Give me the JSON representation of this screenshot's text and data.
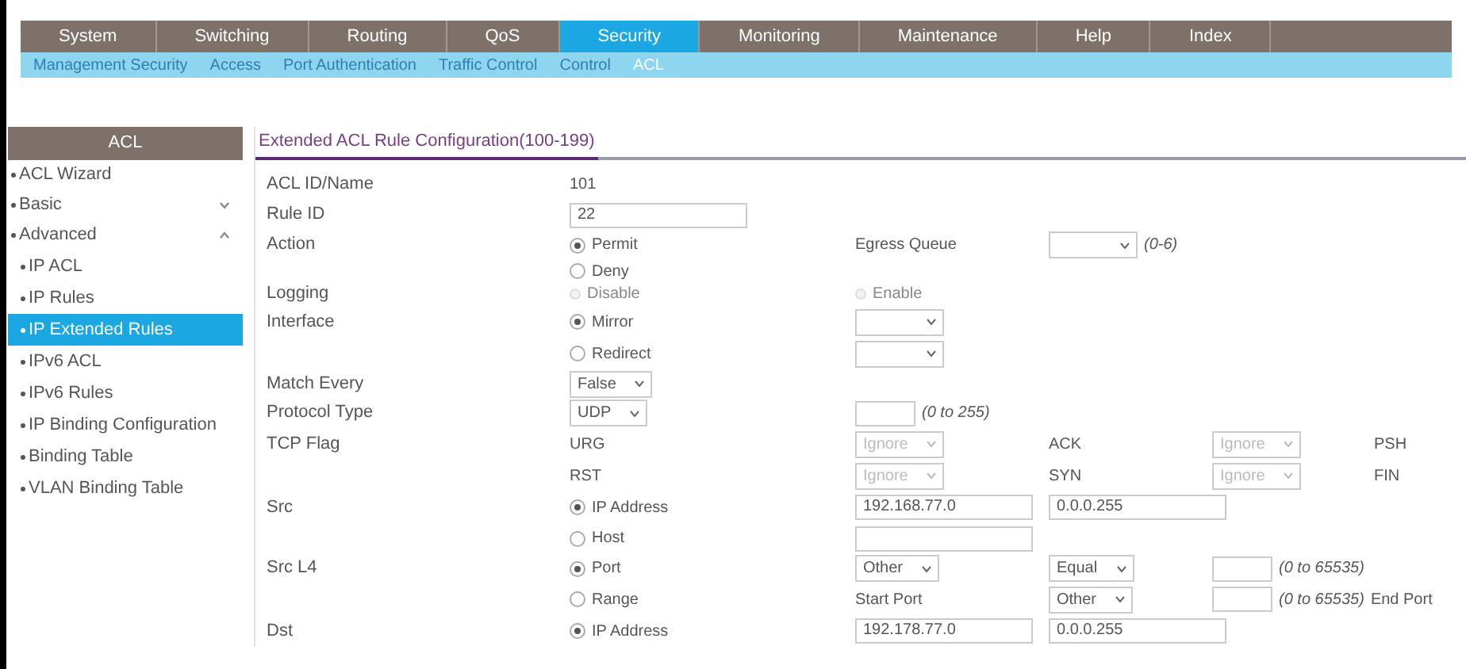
{
  "top_nav": [
    {
      "label": "System",
      "selected": false
    },
    {
      "label": "Switching",
      "selected": false
    },
    {
      "label": "Routing",
      "selected": false
    },
    {
      "label": "QoS",
      "selected": false
    },
    {
      "label": "Security",
      "selected": true
    },
    {
      "label": "Monitoring",
      "selected": false
    },
    {
      "label": "Maintenance",
      "selected": false
    },
    {
      "label": "Help",
      "selected": false
    },
    {
      "label": "Index",
      "selected": false
    }
  ],
  "sub_nav": [
    {
      "label": "Management Security",
      "selected": false
    },
    {
      "label": "Access",
      "selected": false
    },
    {
      "label": "Port Authentication",
      "selected": false
    },
    {
      "label": "Traffic Control",
      "selected": false
    },
    {
      "label": "Control",
      "selected": false
    },
    {
      "label": "ACL",
      "selected": true
    }
  ],
  "sidebar": {
    "title": "ACL",
    "items": [
      {
        "label": "ACL Wizard",
        "selected": false
      },
      {
        "label": "Basic",
        "selected": false,
        "expanded": false
      },
      {
        "label": "Advanced",
        "selected": false,
        "expanded": true,
        "children": [
          {
            "label": "IP ACL",
            "selected": false
          },
          {
            "label": "IP Rules",
            "selected": false
          },
          {
            "label": "IP Extended Rules",
            "selected": true
          },
          {
            "label": "IPv6 ACL",
            "selected": false
          },
          {
            "label": "IPv6 Rules",
            "selected": false
          },
          {
            "label": "IP Binding Configuration",
            "selected": false
          },
          {
            "label": "Binding Table",
            "selected": false
          },
          {
            "label": "VLAN Binding Table",
            "selected": false
          }
        ]
      }
    ]
  },
  "section_title": "Extended ACL Rule Configuration(100-199)",
  "form_rows": [
    {
      "label": "ACL ID/Name",
      "cells": [
        {
          "kind": "text",
          "text": "101"
        }
      ]
    },
    {
      "label": "Rule ID",
      "cells": [
        {
          "kind": "input",
          "value": "22"
        }
      ]
    },
    {
      "label": "Action",
      "cells": [
        {
          "kind": "radio",
          "text": "Permit",
          "selected": true,
          "disabled": false
        },
        {
          "kind": "text",
          "text": "Egress Queue"
        },
        {
          "kind": "select",
          "disabled": false
        },
        {
          "kind": "hint",
          "text": "(0-6)"
        }
      ]
    },
    {
      "cells": [
        {
          "kind": "radio",
          "text": "Deny",
          "selected": false,
          "disabled": false
        }
      ]
    },
    {
      "label": "Logging",
      "cells": [
        {
          "kind": "radio",
          "text": "Disable",
          "selected": false,
          "disabled": true
        },
        {
          "kind": "radio",
          "text": "Enable",
          "selected": false,
          "disabled": true
        }
      ]
    },
    {
      "label": "Interface",
      "cells": [
        {
          "kind": "radio",
          "text": "Mirror",
          "selected": true,
          "disabled": false
        },
        {
          "kind": "select",
          "disabled": false
        }
      ]
    },
    {
      "cells": [
        {
          "kind": "radio",
          "text": "Redirect",
          "selected": false,
          "disabled": false
        },
        {
          "kind": "select",
          "disabled": false
        }
      ]
    },
    {
      "label": "Match Every",
      "cells": [
        {
          "kind": "select",
          "value": "False",
          "disabled": false
        }
      ]
    },
    {
      "label": "Protocol Type",
      "cells": [
        {
          "kind": "select",
          "value": "UDP",
          "disabled": false
        },
        {
          "kind": "input"
        },
        {
          "kind": "hint",
          "text": "(0 to 255)"
        }
      ]
    },
    {
      "label": "TCP Flag",
      "cells": [
        {
          "kind": "text",
          "text": "URG"
        },
        {
          "kind": "select",
          "value": "Ignore",
          "disabled": true
        },
        {
          "kind": "text",
          "text": "ACK"
        },
        {
          "kind": "select",
          "value": "Ignore",
          "disabled": true
        },
        {
          "kind": "text",
          "text": "PSH"
        }
      ]
    },
    {
      "cells": [
        {
          "kind": "text",
          "text": "RST"
        },
        {
          "kind": "select",
          "value": "Ignore",
          "disabled": true
        },
        {
          "kind": "text",
          "text": "SYN"
        },
        {
          "kind": "select",
          "value": "Ignore",
          "disabled": true
        },
        {
          "kind": "text",
          "text": "FIN"
        }
      ]
    },
    {
      "label": "Src",
      "cells": [
        {
          "kind": "radio",
          "text": "IP Address",
          "selected": true,
          "disabled": false
        },
        {
          "kind": "input",
          "value": "192.168.77.0"
        },
        {
          "kind": "input",
          "value": "0.0.0.255"
        }
      ]
    },
    {
      "cells": [
        {
          "kind": "radio",
          "text": "Host",
          "selected": false,
          "disabled": false
        },
        {
          "kind": "input"
        }
      ]
    },
    {
      "label": "Src L4",
      "cells": [
        {
          "kind": "radio",
          "text": "Port",
          "selected": true,
          "disabled": false
        },
        {
          "kind": "select",
          "value": "Other",
          "disabled": false
        },
        {
          "kind": "select",
          "value": "Equal",
          "disabled": false
        },
        {
          "kind": "input"
        },
        {
          "kind": "hint",
          "text": "(0 to 65535)"
        }
      ]
    },
    {
      "cells": [
        {
          "kind": "radio",
          "text": "Range",
          "selected": false,
          "disabled": false
        },
        {
          "kind": "text",
          "text": "Start Port"
        },
        {
          "kind": "select",
          "value": "Other",
          "disabled": false
        },
        {
          "kind": "input"
        },
        {
          "kind": "hint",
          "text": "(0 to 65535)"
        },
        {
          "kind": "text",
          "text": "End Port"
        }
      ]
    },
    {
      "label": "Dst",
      "cells": [
        {
          "kind": "radio",
          "text": "IP Address",
          "selected": true,
          "disabled": false
        },
        {
          "kind": "input",
          "value": "192.178.77.0"
        },
        {
          "kind": "input",
          "value": "0.0.0.255"
        }
      ]
    }
  ]
}
